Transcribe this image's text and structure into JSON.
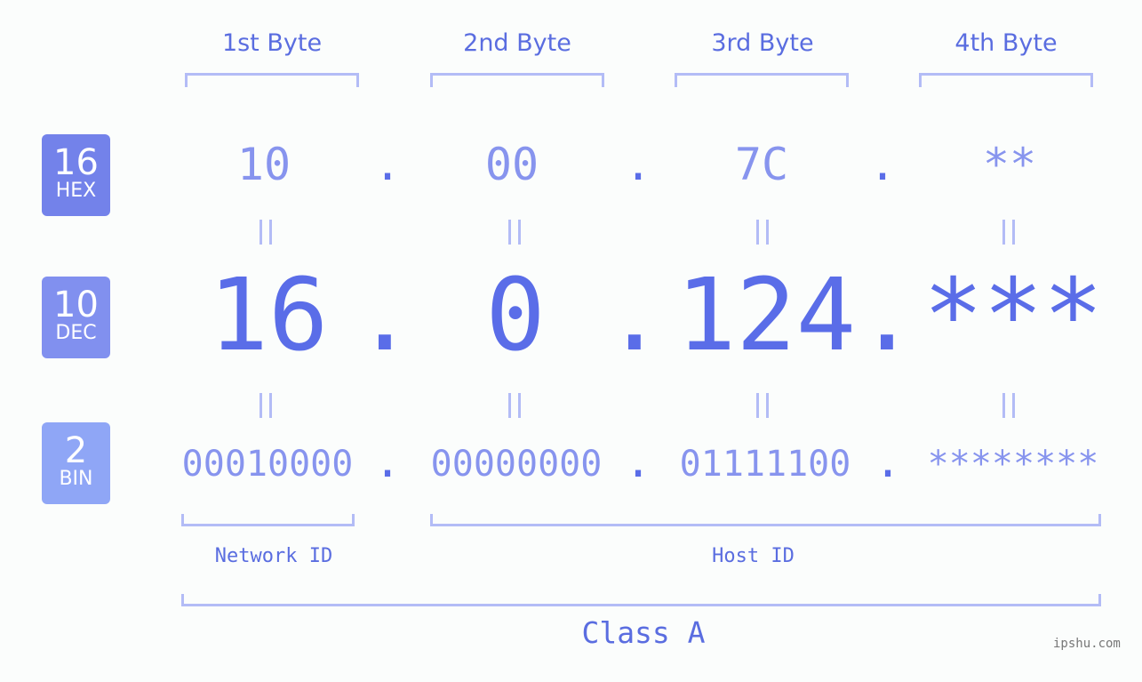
{
  "headers": [
    "1st Byte",
    "2nd Byte",
    "3rd Byte",
    "4th Byte"
  ],
  "badges": [
    {
      "num": "16",
      "label": "HEX",
      "color": "#7382ea"
    },
    {
      "num": "10",
      "label": "DEC",
      "color": "#8190ef"
    },
    {
      "num": "2",
      "label": "BIN",
      "color": "#8fa6f6"
    }
  ],
  "hex": [
    "10",
    "00",
    "7C",
    "**"
  ],
  "dec": [
    "16",
    "0",
    "124",
    "***"
  ],
  "bin": [
    "00010000",
    "00000000",
    "01111100",
    "********"
  ],
  "separator": ".",
  "network_id_label": "Network ID",
  "host_id_label": "Host ID",
  "class_label": "Class A",
  "watermark": "ipshu.com"
}
